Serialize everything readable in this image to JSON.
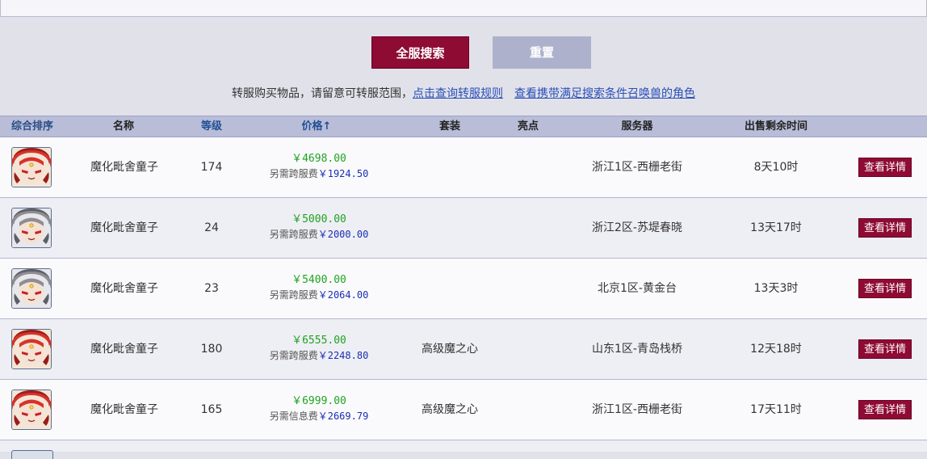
{
  "buttons": {
    "search": "全服搜索",
    "reset": "重置"
  },
  "notice": {
    "text": "转服购买物品，请留意可转服范围，",
    "link_rules": "点击查询转服规则",
    "link_roles": "查看携带满足搜索条件召唤兽的角色"
  },
  "table": {
    "headers": {
      "rank": "综合排序",
      "name": "名称",
      "level": "等级",
      "price": "价格",
      "set": "套装",
      "highlight": "亮点",
      "server": "服务器",
      "time": "出售剩余时间"
    },
    "sort_arrow": "↑",
    "rows": [
      {
        "avatar": "red",
        "name": "魔化毗舍童子",
        "level": "174",
        "price": "￥4698.00",
        "fee_label": "另需跨服费",
        "fee": "￥1924.50",
        "set": "",
        "highlight": "",
        "server": "浙江1区-西栅老街",
        "time": "8天10时",
        "action": "查看详情"
      },
      {
        "avatar": "gray",
        "name": "魔化毗舍童子",
        "level": "24",
        "price": "￥5000.00",
        "fee_label": "另需跨服费",
        "fee": "￥2000.00",
        "set": "",
        "highlight": "",
        "server": "浙江2区-苏堤春晓",
        "time": "13天17时",
        "action": "查看详情"
      },
      {
        "avatar": "gray",
        "name": "魔化毗舍童子",
        "level": "23",
        "price": "￥5400.00",
        "fee_label": "另需跨服费",
        "fee": "￥2064.00",
        "set": "",
        "highlight": "",
        "server": "北京1区-黄金台",
        "time": "13天3时",
        "action": "查看详情"
      },
      {
        "avatar": "red",
        "name": "魔化毗舍童子",
        "level": "180",
        "price": "￥6555.00",
        "fee_label": "另需跨服费",
        "fee": "￥2248.80",
        "set": "高级魔之心",
        "highlight": "",
        "server": "山东1区-青岛栈桥",
        "time": "12天18时",
        "action": "查看详情"
      },
      {
        "avatar": "red",
        "name": "魔化毗舍童子",
        "level": "165",
        "price": "￥6999.00",
        "fee_label": "另需信息费",
        "fee": "￥2669.79",
        "set": "高级魔之心",
        "highlight": "",
        "server": "浙江1区-西栅老街",
        "time": "17天11时",
        "action": "查看详情"
      }
    ]
  },
  "colors": {
    "accent": "#8e0b33",
    "reset": "#aeb1cc",
    "header_bg": "#b9bdd8",
    "price": "#1fa31f",
    "fee": "#1a2fb0",
    "link": "#2a4fb6"
  }
}
